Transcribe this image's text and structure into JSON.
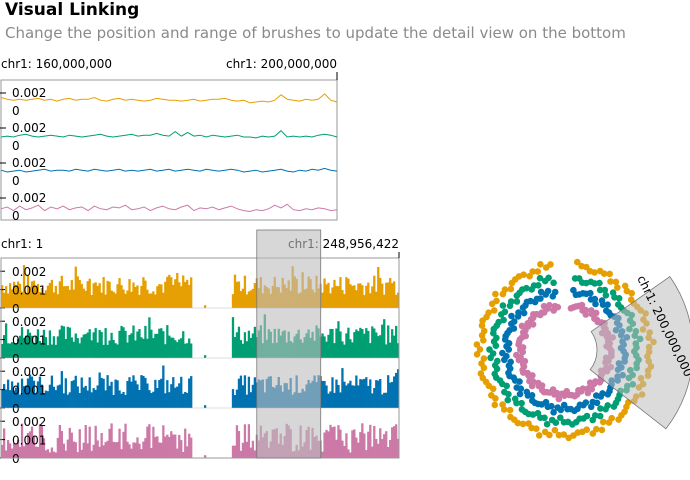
{
  "header": {
    "title": "Visual Linking",
    "subtitle": "Change the position and range of brushes to update the detail view on the bottom"
  },
  "colors": {
    "series": [
      "#e69f00",
      "#009e73",
      "#0072b2",
      "#cc79a7"
    ],
    "brush_fill": "#bdbdbd",
    "axis": "#000000"
  },
  "chart_data": [
    {
      "type": "line",
      "name": "detail-view",
      "x_range_labels": [
        "chr1: 160,000,000",
        "chr1: 200,000,000"
      ],
      "x_domain": [
        160000000,
        200000000
      ],
      "rows": 4,
      "y_tick_labels": [
        "0.002",
        "0"
      ],
      "ylim": [
        0,
        0.003
      ],
      "series": [
        {
          "values": [
            0.0015,
            0.0013,
            0.0012,
            0.0013,
            0.0012,
            0.0013,
            0.0014,
            0.0012,
            0.0013,
            0.0011,
            0.0013,
            0.0014,
            0.0012,
            0.0013,
            0.0013,
            0.0015,
            0.0012,
            0.0011,
            0.0013,
            0.0014,
            0.0012,
            0.0013,
            0.0012,
            0.0011,
            0.0012,
            0.0014,
            0.0013,
            0.0012,
            0.0012,
            0.0011,
            0.0012,
            0.0013,
            0.0011,
            0.0012,
            0.0013,
            0.0013,
            0.0014,
            0.0012,
            0.0011,
            0.0012,
            0.0009,
            0.001,
            0.0011,
            0.001,
            0.0012,
            0.0018,
            0.0013,
            0.0012,
            0.0011,
            0.0013,
            0.0012,
            0.0013,
            0.0019,
            0.0012,
            0.001
          ]
        },
        {
          "values": [
            0.001,
            0.0011,
            0.001,
            0.0012,
            0.0013,
            0.0011,
            0.001,
            0.0011,
            0.0012,
            0.0011,
            0.001,
            0.0012,
            0.0011,
            0.001,
            0.0011,
            0.0012,
            0.0013,
            0.0011,
            0.001,
            0.0011,
            0.0012,
            0.0013,
            0.0011,
            0.0012,
            0.0012,
            0.0014,
            0.0012,
            0.0011,
            0.0016,
            0.0011,
            0.0015,
            0.0011,
            0.0012,
            0.001,
            0.0012,
            0.0011,
            0.001,
            0.0011,
            0.0012,
            0.001,
            0.001,
            0.0009,
            0.0011,
            0.001,
            0.0011,
            0.0017,
            0.001,
            0.0011,
            0.001,
            0.0011,
            0.001,
            0.0012,
            0.0013,
            0.0012,
            0.001
          ]
        },
        {
          "values": [
            0.0012,
            0.001,
            0.0011,
            0.0012,
            0.001,
            0.0011,
            0.0012,
            0.0013,
            0.0011,
            0.0012,
            0.0012,
            0.0011,
            0.0013,
            0.0012,
            0.0011,
            0.0013,
            0.0012,
            0.0011,
            0.0012,
            0.0013,
            0.0011,
            0.0012,
            0.0011,
            0.0012,
            0.0013,
            0.0011,
            0.0012,
            0.0013,
            0.0011,
            0.0012,
            0.0013,
            0.0012,
            0.0011,
            0.0013,
            0.0012,
            0.0011,
            0.0012,
            0.0013,
            0.0012,
            0.001,
            0.0011,
            0.0012,
            0.001,
            0.0011,
            0.0012,
            0.0013,
            0.0011,
            0.001,
            0.0012,
            0.0011,
            0.0013,
            0.0012,
            0.0014,
            0.0012,
            0.0011
          ]
        },
        {
          "values": [
            0.0008,
            0.001,
            0.0006,
            0.0011,
            0.0007,
            0.0009,
            0.0012,
            0.0006,
            0.001,
            0.0008,
            0.0011,
            0.0007,
            0.0009,
            0.001,
            0.0006,
            0.0011,
            0.0008,
            0.0007,
            0.001,
            0.0009,
            0.0012,
            0.0007,
            0.0008,
            0.001,
            0.0006,
            0.0009,
            0.0011,
            0.0008,
            0.0007,
            0.001,
            0.0012,
            0.0006,
            0.0009,
            0.0008,
            0.001,
            0.0007,
            0.0009,
            0.0011,
            0.0008,
            0.0006,
            0.0005,
            0.0007,
            0.0006,
            0.0008,
            0.0012,
            0.0009,
            0.0013,
            0.0007,
            0.0006,
            0.0008,
            0.0007,
            0.0009,
            0.0008,
            0.0006,
            0.0007
          ]
        }
      ]
    },
    {
      "type": "bar",
      "name": "overview",
      "x_range_labels": [
        "chr1: 1",
        "chr1: 248,956,422"
      ],
      "x_domain": [
        1,
        248956422
      ],
      "brush_domain": [
        160000000,
        200000000
      ],
      "rows": 4,
      "y_tick_labels": [
        "0.002",
        "0.001",
        "0"
      ],
      "ylim": [
        0,
        0.0025
      ],
      "gap_start_fraction": 0.475,
      "gap_end_fraction": 0.58
    },
    {
      "type": "scatter",
      "name": "circular-view",
      "layout": "circular",
      "brush_label": "chr1: 200,000,000",
      "brush_domain": [
        160000000,
        200000000
      ],
      "rings": 4
    }
  ]
}
